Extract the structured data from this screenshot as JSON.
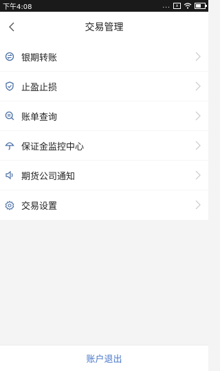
{
  "status_bar": {
    "time": "下午4:08",
    "dots": "...",
    "box_icon_text": "x",
    "battery_level": 0.6
  },
  "nav": {
    "title": "交易管理"
  },
  "menu": {
    "items": [
      {
        "label": "银期转账",
        "icon": "transfer-icon"
      },
      {
        "label": "止盈止损",
        "icon": "shield-check-icon"
      },
      {
        "label": "账单查询",
        "icon": "search-bill-icon"
      },
      {
        "label": "保证金监控中心",
        "icon": "umbrella-icon"
      },
      {
        "label": "期货公司通知",
        "icon": "speaker-icon"
      },
      {
        "label": "交易设置",
        "icon": "gear-icon"
      }
    ]
  },
  "footer": {
    "logout_label": "账户退出"
  },
  "colors": {
    "accent": "#4a78c8",
    "icon": "#4a6fa5",
    "chevron": "#cfcfcf"
  }
}
